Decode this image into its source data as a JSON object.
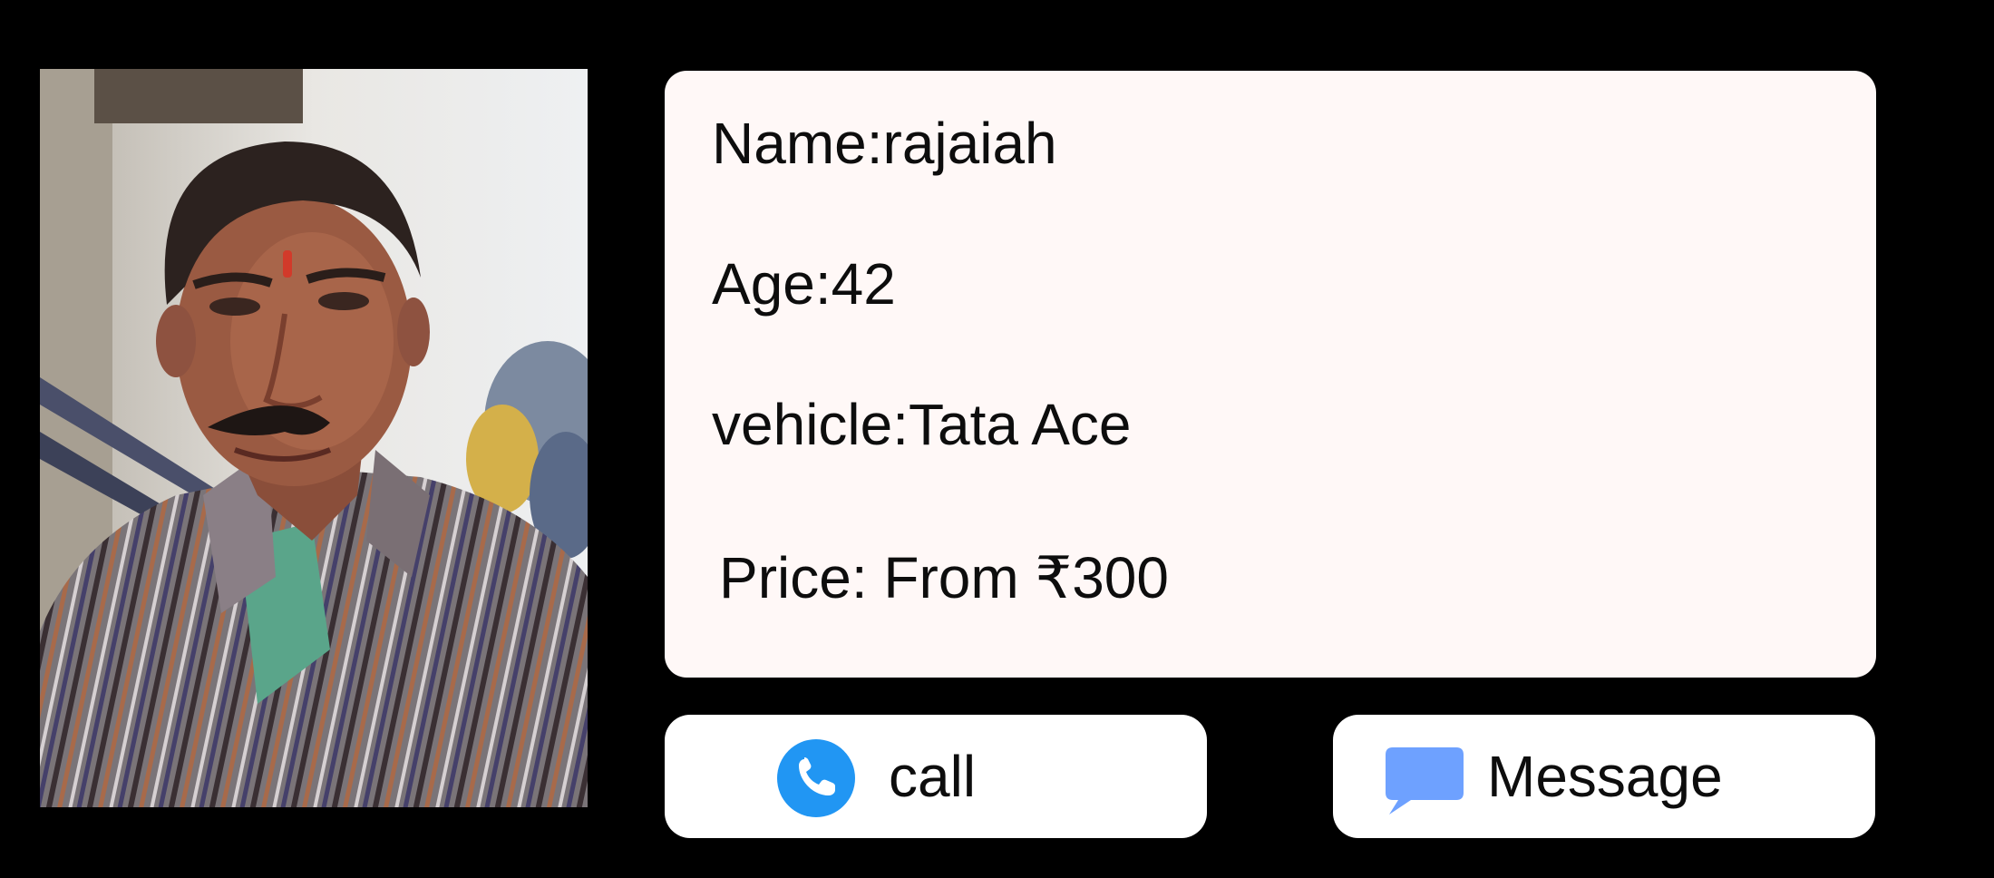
{
  "driver": {
    "name_text": "Name:rajaiah",
    "age_text": "Age:42",
    "vehicle_text": "vehicle:Tata Ace",
    "price_text": "Price: From ₹300"
  },
  "actions": {
    "call_label": "call",
    "call_icon": "phone-icon",
    "message_label": "Message",
    "message_icon": "chat-bubble-icon"
  },
  "colors": {
    "background": "#000000",
    "card": "#fff8f7",
    "button": "#ffffff",
    "call_icon": "#2196f3",
    "message_icon": "#6ea1ff"
  }
}
